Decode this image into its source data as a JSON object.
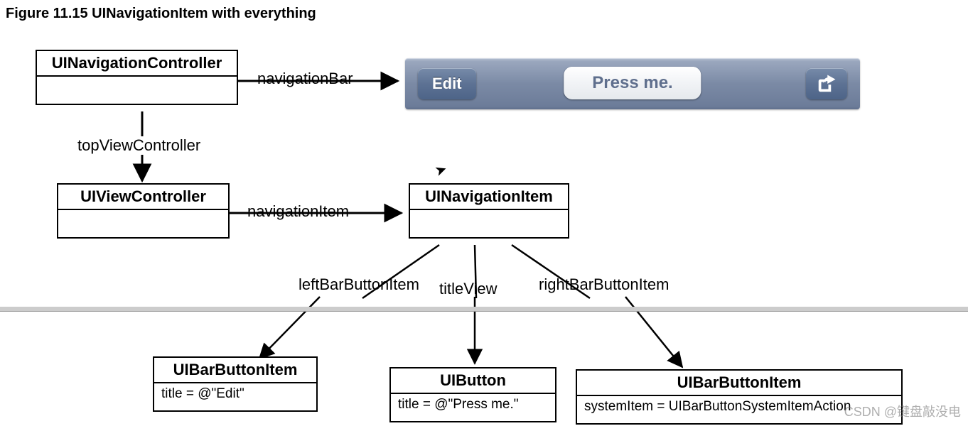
{
  "figure_title": "Figure 11.15  UINavigationItem with everything",
  "boxes": {
    "navController": {
      "header": "UINavigationController"
    },
    "viewController": {
      "header": "UIViewController"
    },
    "navItem": {
      "header": "UINavigationItem"
    },
    "leftItem": {
      "header": "UIBarButtonItem",
      "body": "title = @\"Edit\""
    },
    "button": {
      "header": "UIButton",
      "body": "title = @\"Press me.\""
    },
    "rightItem": {
      "header": "UIBarButtonItem",
      "body": "systemItem = UIBarButtonSystemItemAction"
    }
  },
  "labels": {
    "navBar": "navigationBar",
    "topVC": "topViewController",
    "navItemLbl": "navigationItem",
    "leftLbl": "leftBarButtonItem",
    "titleLbl": "titleView",
    "rightLbl": "rightBarButtonItem"
  },
  "navbar": {
    "edit_label": "Edit",
    "title_label": "Press me.",
    "action_icon": "share-action-icon"
  },
  "watermark": "CSDN @键盘敲没电"
}
